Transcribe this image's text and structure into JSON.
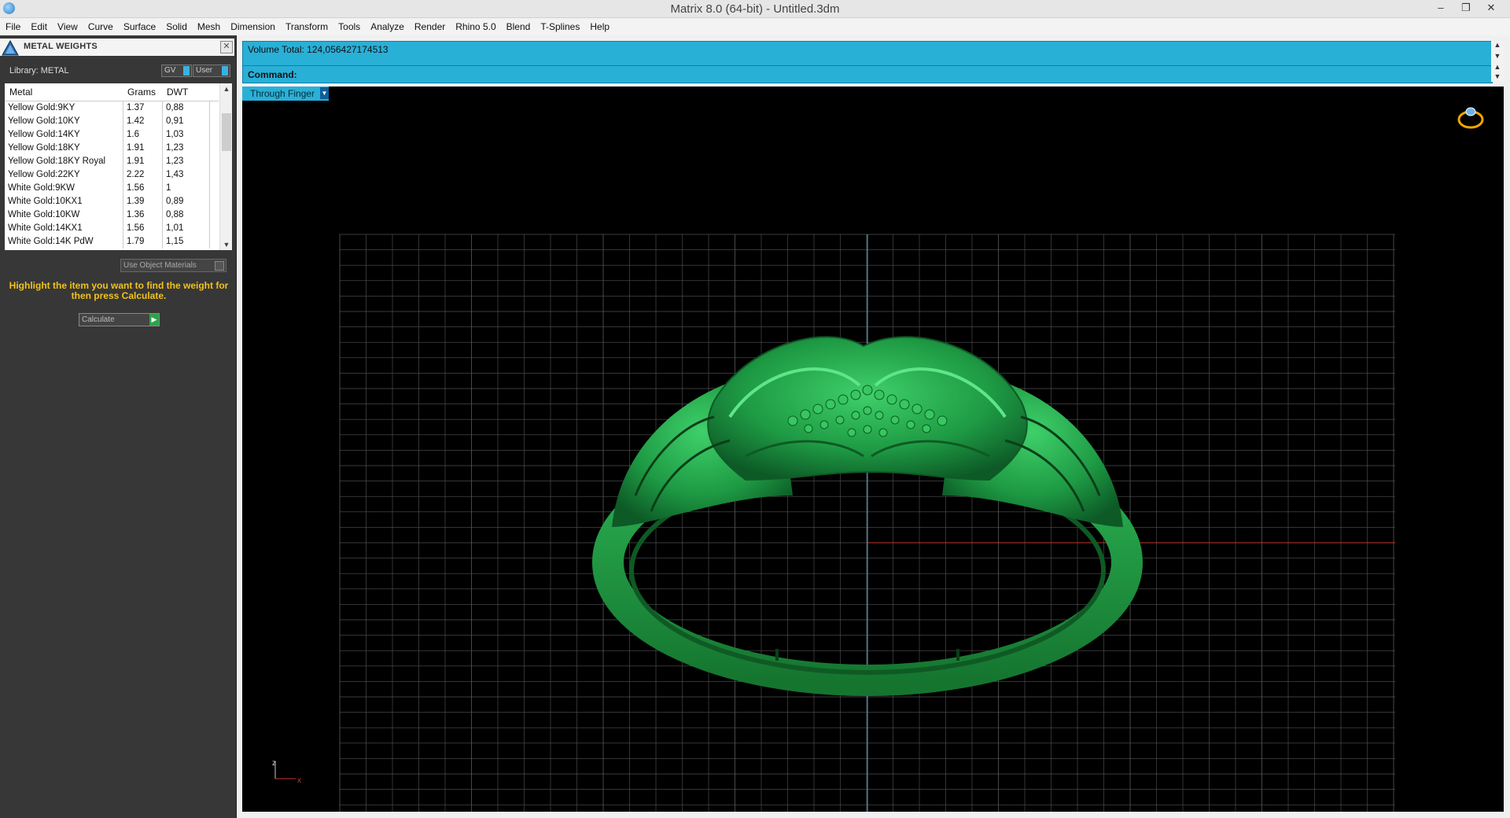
{
  "window": {
    "title": "Matrix 8.0 (64-bit) - Untitled.3dm"
  },
  "menu": [
    "File",
    "Edit",
    "View",
    "Curve",
    "Surface",
    "Solid",
    "Mesh",
    "Dimension",
    "Transform",
    "Tools",
    "Analyze",
    "Render",
    "Rhino 5.0",
    "Blend",
    "T-Splines",
    "Help"
  ],
  "panel": {
    "title": "METAL WEIGHTS",
    "library_label": "Library: METAL",
    "gv_button": "GV",
    "user_button": "User",
    "columns": [
      "Metal",
      "Grams",
      "DWT"
    ],
    "rows": [
      {
        "metal": "Yellow Gold:9KY",
        "grams": "1.37",
        "dwt": "0,88"
      },
      {
        "metal": "Yellow Gold:10KY",
        "grams": "1.42",
        "dwt": "0,91"
      },
      {
        "metal": "Yellow Gold:14KY",
        "grams": "1.6",
        "dwt": "1,03"
      },
      {
        "metal": "Yellow Gold:18KY",
        "grams": "1.91",
        "dwt": "1,23"
      },
      {
        "metal": "Yellow Gold:18KY Royal",
        "grams": "1.91",
        "dwt": "1,23"
      },
      {
        "metal": "Yellow Gold:22KY",
        "grams": "2.22",
        "dwt": "1,43"
      },
      {
        "metal": "White Gold:9KW",
        "grams": "1.56",
        "dwt": "1"
      },
      {
        "metal": "White Gold:10KX1",
        "grams": "1.39",
        "dwt": "0,89"
      },
      {
        "metal": "White Gold:10KW",
        "grams": "1.36",
        "dwt": "0,88"
      },
      {
        "metal": "White Gold:14KX1",
        "grams": "1.56",
        "dwt": "1,01"
      },
      {
        "metal": "White Gold:14K PdW",
        "grams": "1.79",
        "dwt": "1,15"
      }
    ],
    "use_object_materials": "Use Object Materials",
    "hint": "Highlight the item you want to find the weight for then press Calculate.",
    "calculate": "Calculate"
  },
  "command": {
    "volume": "Volume Total: 124,056427174513",
    "prompt": "Command:"
  },
  "viewport": {
    "view_name": "Through Finger",
    "axis_z": "z",
    "axis_x": "x",
    "ring_color": "#24a14a",
    "grid_color": "#555555",
    "x_axis_color": "#c0392b",
    "y_axis_color": "#4aa3d8"
  }
}
